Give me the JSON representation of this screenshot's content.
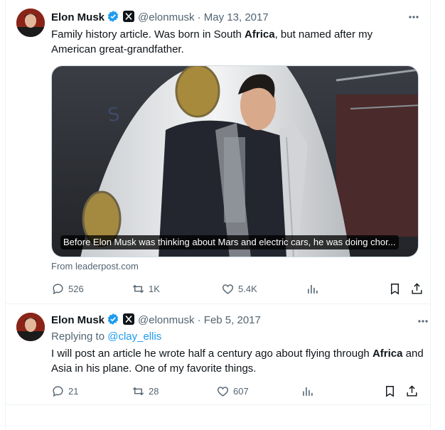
{
  "tweets": [
    {
      "author_name": "Elon Musk",
      "handle": "@elonmusk",
      "dot": "·",
      "date": "May 13, 2017",
      "text_segments": [
        "Family history article. Was born in South ",
        "Africa",
        ", but named after my American great-grandfather."
      ],
      "media_caption": "Before Elon Musk was thinking about Mars and electric cars, he was doing chor...",
      "source": "From leaderpost.com",
      "replies": "526",
      "reposts": "1K",
      "likes": "5.4K"
    },
    {
      "author_name": "Elon Musk",
      "handle": "@elonmusk",
      "dot": "·",
      "date": "Feb 5, 2017",
      "replying_prefix": "Replying to",
      "replying_mention": "@clay_ellis",
      "text_segments": [
        "I will post an article he wrote half a century ago about flying through ",
        "Africa",
        " and Asia in his plane. One of my favorite things."
      ],
      "replies": "21",
      "reposts": "28",
      "likes": "607"
    }
  ],
  "colors": {
    "verified": "#1d9bf0",
    "secondary_text": "#536471",
    "link": "#1d9bf0",
    "border": "#eff3f4"
  },
  "icons": [
    "verified-badge-icon",
    "x-logo-icon",
    "more-icon",
    "reply-icon",
    "repost-icon",
    "like-icon",
    "views-icon",
    "bookmark-icon",
    "share-icon"
  ]
}
